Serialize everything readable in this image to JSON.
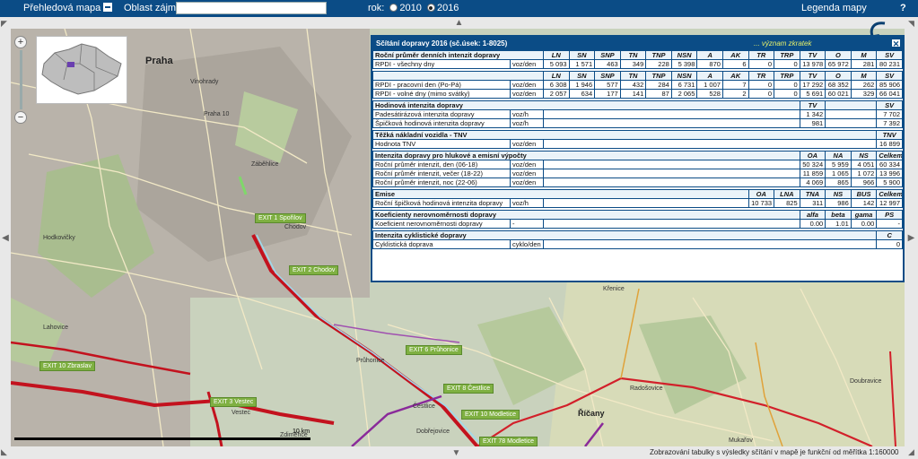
{
  "topbar": {
    "overview": "Přehledová mapa",
    "area_label": "Oblast zájmu:",
    "area_value": "",
    "year_label": "rok:",
    "year_2010": "2010",
    "year_2016": "2016",
    "legend": "Legenda mapy",
    "help": "?"
  },
  "map": {
    "places": [
      {
        "t": "Praha",
        "big": true
      },
      {
        "t": "Vinohrady"
      },
      {
        "t": "Praha 10"
      },
      {
        "t": "Záběhlice"
      },
      {
        "t": "Chodov"
      },
      {
        "t": "Hodkovičky"
      },
      {
        "t": "Lahovice"
      },
      {
        "t": "Průhonice"
      },
      {
        "t": "Čestlice"
      },
      {
        "t": "Dobřejovice"
      },
      {
        "t": "Říčany"
      },
      {
        "t": "Křenice"
      },
      {
        "t": "Doubravice"
      },
      {
        "t": "Mukařov"
      },
      {
        "t": "Zdiměřice"
      },
      {
        "t": "Vestec"
      },
      {
        "t": "Radošovice"
      }
    ],
    "exits": [
      "EXIT 1 Spořilov",
      "EXIT 2 Chodov",
      "EXIT 6 Průhonice",
      "EXIT 8 Čestlice",
      "EXIT 10 Modletice",
      "EXIT 10 Zbraslav",
      "EXIT 3 Vestec",
      "EXIT 78 Modletice"
    ],
    "scale_label": "10 km",
    "footer_note": "Zobrazování tabulky s výsledky sčítání v mapě je funkční od měřítka 1:160000"
  },
  "panel": {
    "title": "Sčítání dopravy 2016 (sč.úsek: 1-8025)",
    "link": "... význam zkratek",
    "close": "✕",
    "annual_title": "Roční průměr denních intenzit dopravy",
    "cols": [
      "LN",
      "SN",
      "SNP",
      "TN",
      "TNP",
      "NSN",
      "A",
      "AK",
      "TR",
      "TRP",
      "TV",
      "O",
      "M",
      "SV"
    ],
    "rows_annual": [
      {
        "label": "RPDI - všechny dny",
        "unit": "voz/den",
        "v": [
          "5 093",
          "1 571",
          "463",
          "349",
          "228",
          "5 398",
          "870",
          "6",
          "0",
          "0",
          "13 978",
          "65 972",
          "281",
          "80 231"
        ]
      }
    ],
    "rows_days": [
      {
        "label": "RPDI - pracovní den (Po-Pá)",
        "unit": "voz/den",
        "v": [
          "6 308",
          "1 946",
          "577",
          "432",
          "284",
          "6 731",
          "1 007",
          "7",
          "0",
          "0",
          "17 292",
          "68 352",
          "262",
          "85 906"
        ]
      },
      {
        "label": "RPDI - volné dny (mimo svátky)",
        "unit": "voz/den",
        "v": [
          "2 057",
          "634",
          "177",
          "141",
          "87",
          "2 065",
          "528",
          "2",
          "0",
          "0",
          "5 691",
          "60 021",
          "329",
          "66 041"
        ]
      }
    ],
    "hourly": {
      "title": "Hodinová intenzita dopravy",
      "c1": "TV",
      "c2": "SV",
      "rows": [
        {
          "label": "Padesátirázová intenzita dopravy",
          "unit": "voz/h",
          "a": "1 342",
          "b": "7 702"
        },
        {
          "label": "Špičková hodinová intenzita dopravy",
          "unit": "voz/h",
          "a": "981",
          "b": "7 392"
        }
      ]
    },
    "heavy": {
      "title": "Těžká nákladní vozidla - TNV",
      "c1": "TNV",
      "rows": [
        {
          "label": "Hodnota TNV",
          "unit": "voz/den",
          "a": "16 899"
        }
      ]
    },
    "noise": {
      "title": "Intenzita dopravy pro hlukové a emisní výpočty",
      "cols": [
        "OA",
        "NA",
        "NS",
        "Celkem"
      ],
      "rows": [
        {
          "label": "Roční průměr intenzit, den (06-18)",
          "unit": "voz/den",
          "v": [
            "50 324",
            "5 959",
            "4 051",
            "60 334"
          ]
        },
        {
          "label": "Roční průměr intenzit, večer (18-22)",
          "unit": "voz/den",
          "v": [
            "11 859",
            "1 065",
            "1 072",
            "13 996"
          ]
        },
        {
          "label": "Roční průměr intenzit, noc (22-06)",
          "unit": "voz/den",
          "v": [
            "4 069",
            "865",
            "966",
            "5 900"
          ]
        }
      ]
    },
    "emise": {
      "title": "Emise",
      "cols": [
        "OA",
        "LNA",
        "TNA",
        "NS",
        "BUS",
        "Celkem"
      ],
      "rows": [
        {
          "label": "Roční špičková hodinová intenzita dopravy",
          "unit": "voz/h",
          "v": [
            "10 733",
            "825",
            "311",
            "986",
            "142",
            "12 997"
          ]
        }
      ]
    },
    "koef": {
      "title": "Koeficienty nerovnoměrnosti dopravy",
      "cols": [
        "alfa",
        "beta",
        "gama",
        "PS"
      ],
      "rows": [
        {
          "label": "Koeficient nerovnoměrnosti dopravy",
          "unit": "-",
          "v": [
            "0.00",
            "1.01",
            "0.00",
            "-"
          ]
        }
      ]
    },
    "cyklo": {
      "title": "Intenzita cyklistické dopravy",
      "c1": "C",
      "rows": [
        {
          "label": "Cyklistická doprava",
          "unit": "cyklo/den",
          "a": "0"
        }
      ]
    }
  }
}
